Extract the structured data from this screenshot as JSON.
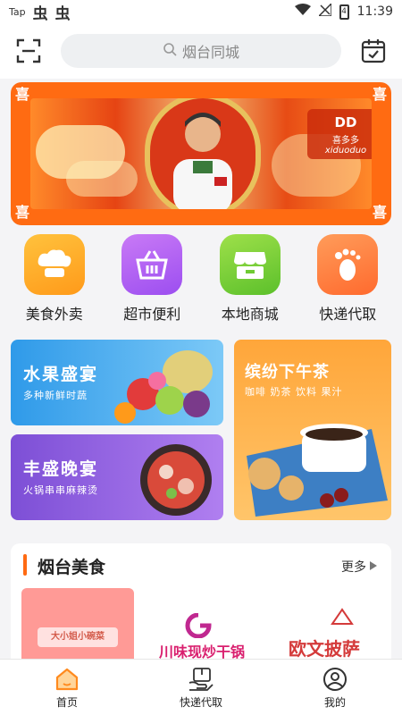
{
  "status_bar": {
    "carrier": "Tap",
    "notif_glyphs": [
      "虫",
      "虫"
    ],
    "time": "11:39",
    "battery": "4"
  },
  "header": {
    "search_placeholder": "烟台同城",
    "scan_icon": "scan-icon",
    "calendar_icon": "calendar-check-icon"
  },
  "banner": {
    "corner_char": "喜",
    "brand_cn": "喜多多",
    "brand_en": "xiduoduo",
    "brand_mark": "DD"
  },
  "categories": [
    {
      "label": "美食外卖",
      "icon": "chef-hat-icon",
      "color_from": "#ffc23d",
      "color_to": "#ff9a1a"
    },
    {
      "label": "超市便利",
      "icon": "basket-icon",
      "color_from": "#c97af6",
      "color_to": "#9c4ef0"
    },
    {
      "label": "本地商城",
      "icon": "store-icon",
      "color_from": "#9ee04a",
      "color_to": "#5cc02b"
    },
    {
      "label": "快递代取",
      "icon": "footprint-icon",
      "color_from": "#ff9c5a",
      "color_to": "#ff6a2e"
    }
  ],
  "promos": {
    "fruit": {
      "title": "水果盛宴",
      "subtitle": "多种新鲜时蔬",
      "color": "#3aa6ee"
    },
    "dinner": {
      "title": "丰盛晚宴",
      "subtitle": "火锅串串麻辣烫",
      "color": "#8f5ad9"
    },
    "tea": {
      "title": "缤纷下午茶",
      "subtitle": "咖啡 奶茶 饮料 果汁",
      "color": "#ffa63a"
    }
  },
  "section": {
    "title": "烟台美食",
    "more_label": "更多",
    "shops": [
      {
        "name": "大小姐小碗菜"
      },
      {
        "name": "川味现炒干锅"
      },
      {
        "name": "欧文披萨"
      }
    ]
  },
  "tabbar": {
    "tabs": [
      {
        "label": "首页",
        "icon": "home-icon",
        "active": true
      },
      {
        "label": "快递代取",
        "icon": "package-icon",
        "active": false
      },
      {
        "label": "我的",
        "icon": "user-icon",
        "active": false
      }
    ],
    "active_color": "#ff8a1e"
  },
  "colors": {
    "accent": "#ff6a12",
    "banner_bg": "#ff6b12"
  }
}
